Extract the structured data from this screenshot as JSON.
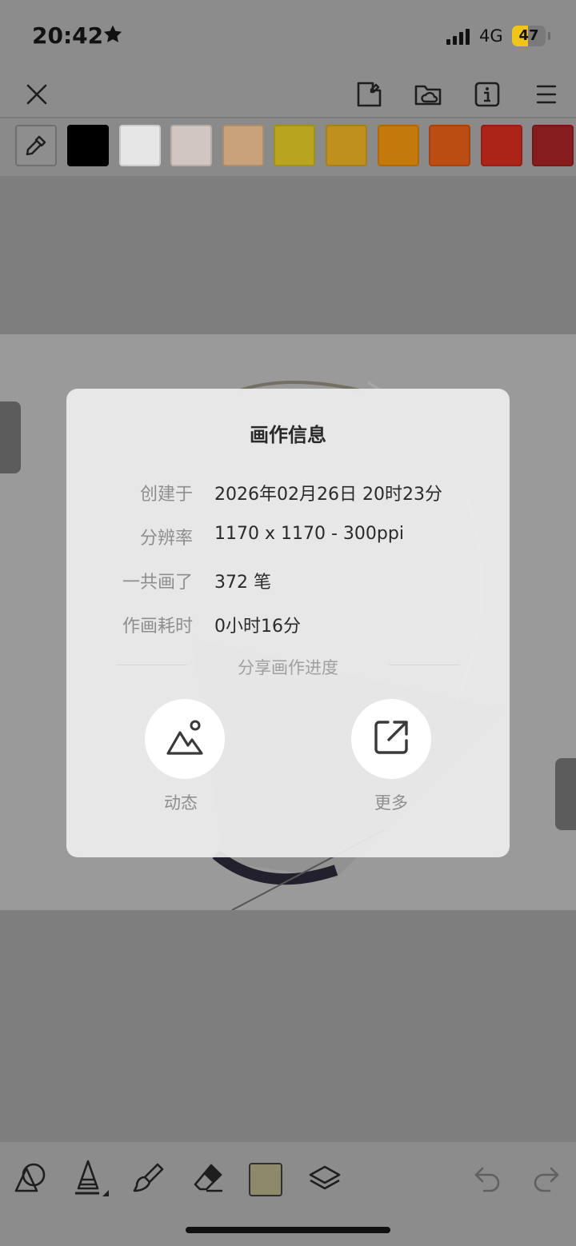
{
  "status_bar": {
    "time": "20:42",
    "network": "4G",
    "battery_level": "47",
    "battery_fraction": 0.47,
    "icons": [
      "star-icon",
      "signal-icon"
    ]
  },
  "top_toolbar": {
    "icons": [
      "close-icon",
      "save-page-icon",
      "cloud-folder-icon",
      "info-icon",
      "menu-icon"
    ]
  },
  "palette": {
    "tool_icon": "eyedropper-icon",
    "colors": [
      "#000000",
      "#e6e6e6",
      "#d2c6c0",
      "#c8a27a",
      "#b8a41e",
      "#bf901d",
      "#c47a0a",
      "#bb4d13",
      "#ab2417",
      "#861c1e"
    ]
  },
  "modal": {
    "title": "画作信息",
    "rows": [
      {
        "label": "创建于",
        "value": "2026年02月26日 20时23分"
      },
      {
        "label": "分辨率",
        "value": "1170 x 1170 - 300ppi"
      },
      {
        "label": "一共画了",
        "value": "372 笔"
      },
      {
        "label": "作画耗时",
        "value": "0小时16分"
      }
    ],
    "share_title": "分享画作进度",
    "buttons": [
      {
        "label": "动态",
        "icon": "mountain-image-icon"
      },
      {
        "label": "更多",
        "icon": "external-link-icon"
      }
    ]
  },
  "bottom_toolbar": {
    "icons": [
      "shapes-icon",
      "pen-tool-icon",
      "brush-icon",
      "eraser-icon",
      "layers-icon",
      "undo-icon",
      "redo-icon"
    ],
    "current_color": "#8c8a6b"
  }
}
